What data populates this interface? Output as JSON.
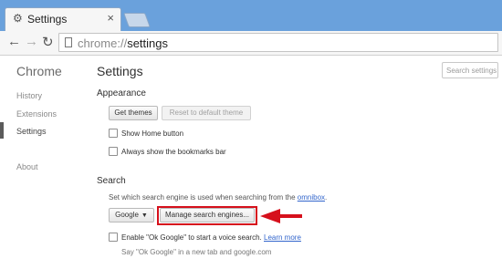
{
  "browser": {
    "tab_title": "Settings",
    "url_scheme": "chrome://",
    "url_host": "settings"
  },
  "sidebar": {
    "title": "Chrome",
    "items": [
      {
        "label": "History"
      },
      {
        "label": "Extensions"
      },
      {
        "label": "Settings",
        "active": true
      },
      {
        "label": "About"
      }
    ]
  },
  "main": {
    "title": "Settings",
    "search_placeholder": "Search settings",
    "appearance": {
      "title": "Appearance",
      "get_themes": "Get themes",
      "reset_theme": "Reset to default theme",
      "show_home": "Show Home button",
      "show_bookmarks": "Always show the bookmarks bar"
    },
    "search": {
      "title": "Search",
      "desc_prefix": "Set which search engine is used when searching from the ",
      "desc_link": "omnibox",
      "desc_suffix": ".",
      "engine": "Google",
      "manage": "Manage search engines...",
      "ok_google": "Enable \"Ok Google\" to start a voice search.",
      "learn_more": "Learn more",
      "ok_google_hint": "Say \"Ok Google\" in a new tab and google.com"
    }
  },
  "colors": {
    "annotation": "#d6101c",
    "link": "#3366cc",
    "titlebar": "#6aa1dc"
  }
}
